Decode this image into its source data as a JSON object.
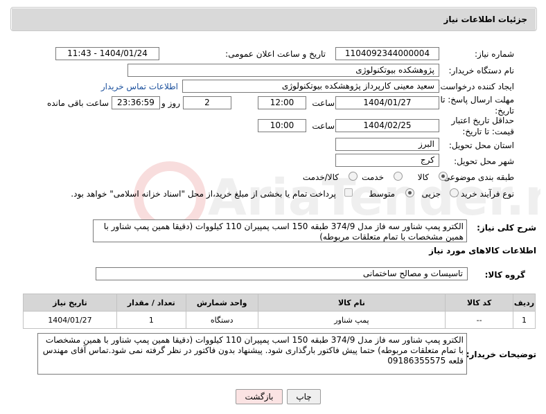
{
  "header": {
    "title": "جزئیات اطلاعات نیاز"
  },
  "form": {
    "need_number": {
      "label": "شماره نیاز:",
      "value": "1104092344000004"
    },
    "announce_datetime": {
      "label": "تاریخ و ساعت اعلان عمومی:",
      "value": "1404/01/24 - 11:43"
    },
    "buyer_org": {
      "label": "نام دستگاه خریدار:",
      "value": "پژوهشکده بیوتکنولوژی"
    },
    "requester": {
      "label": "ایجاد کننده درخواست:",
      "value": "سعید معینی کارپرداز پژوهشکده بیوتکنولوژی",
      "contact_link": "اطلاعات تماس خریدار"
    },
    "reply_deadline": {
      "label": "مهلت ارسال پاسخ: تا تاریخ:",
      "date": "1404/01/27",
      "time_label": "ساعت",
      "time": "12:00",
      "days": "2",
      "days_label": "روز و",
      "remaining": "23:36:59",
      "remaining_label": "ساعت باقی مانده"
    },
    "price_validity": {
      "label": "حداقل تاریخ اعتبار قیمت: تا تاریخ:",
      "date": "1404/02/25",
      "time_label": "ساعت",
      "time": "10:00"
    },
    "province": {
      "label": "استان محل تحویل:",
      "value": "البرز"
    },
    "city": {
      "label": "شهر محل تحویل:",
      "value": "کرج"
    },
    "category": {
      "label": "طبقه بندی موضوعی:",
      "options": [
        "کالا",
        "خدمت",
        "کالا/خدمت"
      ],
      "selected": "کالا"
    },
    "process_type": {
      "label": "نوع فرآیند خرید :",
      "options": [
        "جزیی",
        "متوسط"
      ],
      "selected": "متوسط",
      "payment_note": "پرداخت تمام یا بخشی از مبلغ خرید،از محل \"اسناد خزانه اسلامی\" خواهد بود."
    }
  },
  "description": {
    "label": "شرح کلی نیاز:",
    "value": "الکترو پمپ شناور سه فاز مدل 374/9  طبقه 150 اسب پمپیران 110 کیلووات (دقیقا همین پمپ شناور با همین مشخصات با تمام متعلقات مربوطه)"
  },
  "goods": {
    "section_title": "اطلاعات کالاهای مورد نیاز",
    "group_label": "گروه کالا:",
    "group_value": "تاسیسات و مصالح ساختمانی",
    "columns": [
      "ردیف",
      "کد کالا",
      "نام کالا",
      "واحد شمارش",
      "تعداد / مقدار",
      "تاریخ نیاز"
    ],
    "rows": [
      {
        "row": "1",
        "code": "--",
        "name": "پمپ شناور",
        "unit": "دستگاه",
        "qty": "1",
        "date": "1404/01/27"
      }
    ]
  },
  "buyer_notes": {
    "label": "توضیحات خریدار:",
    "value": "الکترو پمپ شناور سه فاز مدل 374/9  طبقه 150 اسب پمپیران 110 کیلووات (دقیقا همین پمپ شناور با همین مشخصات با تمام متعلقات مربوطه) حتما پیش فاکتور بارگذاری شود. پیشنهاد بدون فاکتور در نظر گرفته نمی شود.تماس آقای مهندس قلعه 09186355575"
  },
  "buttons": {
    "print": "چاپ",
    "back": "بازگشت"
  },
  "watermark": {
    "text": "AriaTender.neT"
  }
}
